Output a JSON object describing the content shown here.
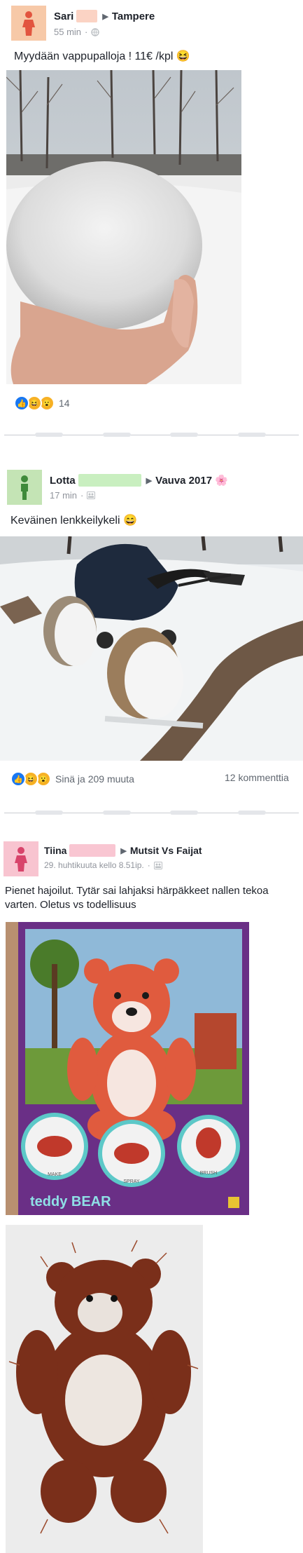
{
  "posts": [
    {
      "author": "Sari",
      "group": "Tampere",
      "time": "55 min",
      "text": "Myydään vappupalloja ! 11€ /kpl 😆",
      "reaction_count": "14"
    },
    {
      "author": "Lotta",
      "group": "Vauva 2017 🌸",
      "time": "17 min",
      "text": "Keväinen lenkkeilykeli 😄",
      "reaction_text": "Sinä ja 209 muuta",
      "comments": "12 kommenttia"
    },
    {
      "author": "Tiina",
      "group": "Mutsit Vs Faijat",
      "time": "29. huhtikuuta kello 8.51ip.",
      "text": "Pienet hajoilut. Tytär sai lahjaksi härpäkkeet nallen tekoa varten.  Oletus vs todellisuus",
      "box_text": "teddy BEAR",
      "box_steps": [
        "MAKE",
        "SPRAY",
        "BRUSH"
      ]
    }
  ],
  "icons": {
    "avatar": "person-icon",
    "group_arrow": "triangle-right-icon",
    "public": "globe-icon",
    "audience": "group-icon",
    "like": "like-icon",
    "haha": "haha-icon",
    "wow": "wow-icon"
  },
  "colors": {
    "avatar_bg_1": "#f7c9a8",
    "avatar_bg_2": "#c4e4b5",
    "avatar_bg_3": "#f8c4d0",
    "redact_1": "#fbd3c4",
    "redact_2": "#c9efc0",
    "redact_3": "#f9c6d2",
    "like_blue": "#1877f2"
  }
}
